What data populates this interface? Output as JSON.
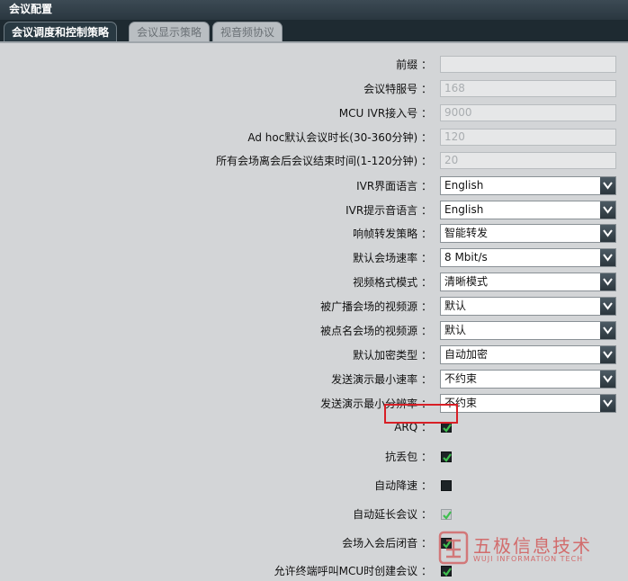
{
  "window": {
    "title": "会议配置"
  },
  "tabs": [
    {
      "label": "会议调度和控制策略",
      "active": true
    },
    {
      "label": "会议显示策略",
      "active": false
    },
    {
      "label": "视音频协议",
      "active": false
    }
  ],
  "fields": {
    "prefix": {
      "label": "前缀 ：",
      "value": ""
    },
    "service_no": {
      "label": "会议特服号 ：",
      "value": "168"
    },
    "ivr_access": {
      "label": "MCU IVR接入号 ：",
      "value": "9000"
    },
    "adhoc_duration": {
      "label": "Ad hoc默认会议时长(30-360分钟) ：",
      "value": "120"
    },
    "end_time": {
      "label": "所有会场离会后会议结束时间(1-120分钟) ：",
      "value": "20"
    }
  },
  "selects": {
    "ivr_ui_lang": {
      "label": "IVR界面语言 ：",
      "value": "English"
    },
    "ivr_prompt_lang": {
      "label": "IVR提示音语言 ：",
      "value": "English"
    },
    "forward_policy": {
      "label": "响帧转发策略 ：",
      "value": "智能转发"
    },
    "default_rate": {
      "label": "默认会场速率 ：",
      "value": "8 Mbit/s"
    },
    "video_format": {
      "label": "视频格式模式 ：",
      "value": "清晰模式"
    },
    "broadcast_source": {
      "label": "被广播会场的视频源 ：",
      "value": "默认"
    },
    "rollcall_source": {
      "label": "被点名会场的视频源 ：",
      "value": "默认"
    },
    "encryption": {
      "label": "默认加密类型 ：",
      "value": "自动加密"
    },
    "min_rate": {
      "label": "发送演示最小速率 ：",
      "value": "不约束"
    },
    "min_resolution": {
      "label": "发送演示最小分辨率 ：",
      "value": "不约束"
    }
  },
  "checks": {
    "arq": {
      "label": "ARQ ：",
      "checked": true
    },
    "anti_loss": {
      "label": "抗丢包 ：",
      "checked": true
    },
    "auto_downspeed": {
      "label": "自动降速 ：",
      "checked": false
    },
    "auto_extend": {
      "label": "自动延长会议 ：",
      "checked": true
    },
    "mute_on_join": {
      "label": "会场入会后闭音 ：",
      "checked": true
    },
    "allow_terminal_create": {
      "label": "允许终端呼叫MCU时创建会议 ：",
      "checked": true
    }
  },
  "watermark": {
    "cn": "五极信息技术",
    "en": "WUJI INFORMATION TECH"
  },
  "colors": {
    "accent_check": "#3fbf4f",
    "highlight": "#d81f26"
  }
}
